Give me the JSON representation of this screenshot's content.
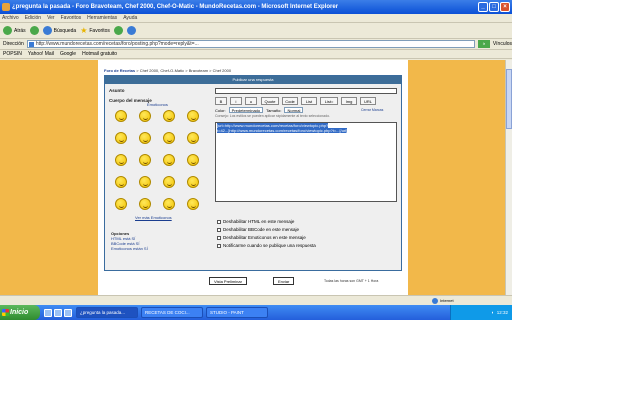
{
  "window": {
    "title": "¿pregunta la pasada - Foro Bravoteam, Chef 2000, Chef-O-Matic - MundoRecetas.com - Microsoft Internet Explorer"
  },
  "menu": [
    "Archivo",
    "Edición",
    "Ver",
    "Favoritos",
    "Herramientas",
    "Ayuda"
  ],
  "toolbar": {
    "back": "Atrás",
    "search": "Búsqueda",
    "favorites": "Favoritos"
  },
  "address": {
    "label": "Dirección",
    "url": "http://www.mundorecetas.com/recetas/foro/posting.php?mode=reply&t=...",
    "go": "Ir",
    "links": "Vínculos"
  },
  "links_bar": [
    "POPSIN",
    "Yahoo! Mail",
    "Google",
    "Hotmail gratuito"
  ],
  "page": {
    "breadcrumb_home": "Foro de Recetas",
    "breadcrumb_rest": "> Chef 2000, Chef-O-Matic > Bravoteam > Chef 2000",
    "form_header": "Publicar una respuesta",
    "subject_label": "Asunto",
    "body_label": "Cuerpo del mensaje",
    "emoticons_title": "Emoticonos",
    "more_emoticons": "Ver más Emoticonos",
    "options_title": "Opciones",
    "options_html": "HTML está SÍ",
    "options_bbcode": "BBCode está SÍ",
    "options_emoticons": "Emoticonos están SÍ",
    "format_buttons": [
      "B",
      "i",
      "u",
      "Quote",
      "Code",
      "List",
      "List=",
      "Img",
      "URL"
    ],
    "font_color_label": "Color:",
    "font_color_value": "Predeterminado",
    "font_size_label": "Tamaño:",
    "font_size_value": "Normal",
    "close_tags": "Cerrar Marcas",
    "tip": "Consejo: Los estilos se pueden aplicar rápidamente al texto seleccionado.",
    "body_text": "[url=http://www.mundorecetas.com/recetas/foro/viewtopic.php?t=42...]http://www.mundorecetas.com/recetas/foro/viewtopic.php?t=...[/url]",
    "checks": [
      "Deshabilitar HTML en este mensaje",
      "Deshabilitar BBCode en este mensaje",
      "Deshabilitar Emoticonos en este mensaje",
      "Notificarme cuando se publique una respuesta"
    ],
    "preview_button": "Vista Preliminar",
    "submit_button": "Enviar",
    "timezone": "Todas las horas son GMT + 1 Hora"
  },
  "status": {
    "zone": "Internet"
  },
  "taskbar": {
    "start": "Inicio",
    "tasks": [
      "¿pregunta la pasada...",
      "RECETAS DE COCI...",
      "STUDIO - PAINT"
    ],
    "clock": "12:32"
  },
  "colors": {
    "page_bg": "#f2b84a",
    "form_header": "#3d6d98",
    "taskbar": "#245edb",
    "start": "#2f8b2f"
  }
}
